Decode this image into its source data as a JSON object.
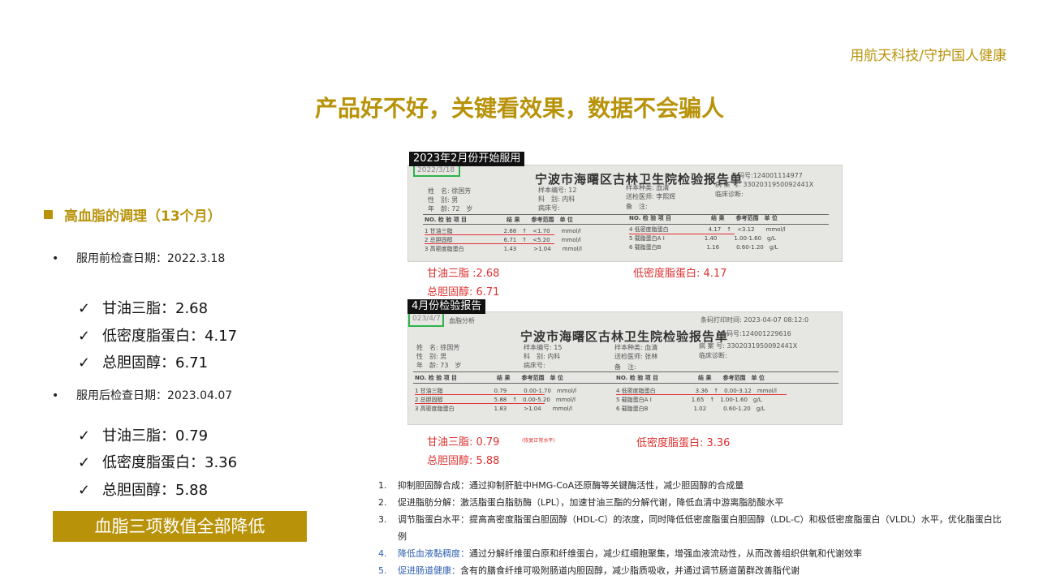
{
  "header": {
    "slogan": "用航天科技/守护国人健康",
    "title": "产品好不好，关键看效果，数据不会骗人"
  },
  "left": {
    "section_title": "高血脂的调理（13个月）",
    "before": {
      "bullet": "•",
      "label": "服用前检查日期：2022.3.18",
      "items": [
        "甘油三脂：2.68",
        "低密度脂蛋白：4.17",
        "总胆固醇：6.71"
      ]
    },
    "after": {
      "bullet": "•",
      "label": "服用后检查日期：2023.04.07",
      "items": [
        "甘油三脂：0.79",
        "低密度脂蛋白：3.36",
        "总胆固醇：5.88"
      ]
    },
    "check_icon": "✓",
    "banner": "血脂三项数值全部降低"
  },
  "report1": {
    "tag": "2023年2月份开始服用",
    "date": "2022/3/18",
    "hospital": "宁波市海曙区古林卫生院检验报告单",
    "barcode": "条码号:124001114977",
    "patient_name": "姓　名: 徐国芳",
    "sex": "性　别: 男",
    "age": "年　龄: 72　岁",
    "sample_no": "样本编号: 12",
    "dept": "科　别: 内科",
    "bed": "病床号:",
    "sample_type": "样本种类: 血清",
    "doctor": "送检医师: 李熙辉",
    "note": "备　注:",
    "case_no": "病 案 号: 3302031950092441X",
    "diag": "临床诊断:",
    "col_left": "NO. 检 验 项 目　　　　　　　结 果　　参考范围　单 位",
    "col_right": "NO. 检 验 项 目　　　　　　　结 果　　参考范围　单 位",
    "rows_left": [
      "1  甘油三脂　　　　　　　　　2.68　↑　<1.70　　mmol/l",
      "2  总胆固醇　　　　　　　　　6.71　↑　<5.20　　mmol/l",
      "3  高密度脂蛋白　　　　　　　1.43　　　>1.04　　mmol/l"
    ],
    "rows_right": [
      "4  低密度脂蛋白　　　　　　　4.17　↑　<3.12　　mmol/l",
      "5  载脂蛋白A I　　　　　　　1.40　　　1.00-1.60　g/L",
      "6  载脂蛋白B　　　　　　　　1.16　　　0.60-1.20　g/L"
    ],
    "red_labels": [
      "甘油三脂 :2.68",
      "总胆固醇: 6.71",
      "低密度脂蛋白: 4.17"
    ]
  },
  "report2": {
    "tag": "4月份检验报告",
    "date": "023/4/7",
    "subtitle": "血脂分析",
    "print_time": "条码打印时间: 2023-04-07 08:12:0",
    "hospital": "宁波市海曙区古林卫生院检验报告单",
    "barcode": "条码号:124001229616",
    "patient_name": "姓　名: 徐国芳",
    "sex": "性　别: 男",
    "age": "年　龄: 73　岁",
    "sample_no": "样本编号: 15",
    "dept": "科　别: 内科",
    "bed": "病床号:",
    "sample_type": "样本种类: 血清",
    "doctor": "送检医师: 张林",
    "note": "备　注:",
    "case_no": "病 案 号: 3302031950092441X",
    "diag": "临床诊断:",
    "col_left": "NO. 检 验 项 目　　　　　　　结 果　　参考范围　单 位",
    "col_right": "NO. 检 验 项 目　　　　　　　结 果　　参考范围　单 位",
    "rows_left": [
      "1  甘油三脂　　　　　　　　　0.79　　　0.00-1.70　mmol/l",
      "2  总胆固醇　　　　　　　　　5.88　↑　0.00-5.20　mmol/l",
      "3  高密度脂蛋白　　　　　　　1.83　　　>1.04　　mmol/l"
    ],
    "rows_right": [
      "4  低密度脂蛋白　　　　　　　3.36　↑　0.00-3.12　mmol/l",
      "5  载脂蛋白A I　　　　　　　1.65　↑　1.00-1.60　g/L",
      "6  载脂蛋白B　　　　　　　　1.02　　　0.60-1.20　g/L"
    ],
    "red_labels": [
      "甘油三脂: 0.79",
      "总胆固醇: 5.88",
      "低密度脂蛋白: 3.36"
    ],
    "red_note": "(恢复正常水平)"
  },
  "notes": [
    {
      "num": "1.",
      "text": "抑制胆固醇合成：通过抑制肝脏中HMG-CoA还原酶等关键酶活性，减少胆固醇的合成量"
    },
    {
      "num": "2.",
      "text": "促进脂肪分解：激活脂蛋白脂肪酶（LPL），加速甘油三酯的分解代谢，降低血清中游离脂肪酸水平"
    },
    {
      "num": "3.",
      "text": "调节脂蛋白水平：提高高密度脂蛋白胆固醇（HDL-C）的浓度，同时降低低密度脂蛋白胆固醇（LDL-C）和极低密度脂蛋白（VLDL）水平，优化脂蛋白比例"
    },
    {
      "num": "4.",
      "label": "降低血液黏稠度：",
      "text": "通过分解纤维蛋白原和纤维蛋白，减少红细胞聚集，增强血液流动性，从而改善组织供氧和代谢效率"
    },
    {
      "num": "5.",
      "label": "促进肠道健康：",
      "text": "含有的膳食纤维可吸附肠道内胆固醇，减少脂质吸收，并通过调节肠道菌群改善脂代谢"
    }
  ],
  "colors": {
    "gold": "#b8930a",
    "red": "#e03030",
    "green": "#2fb34a",
    "blue": "#2d5fb0"
  }
}
